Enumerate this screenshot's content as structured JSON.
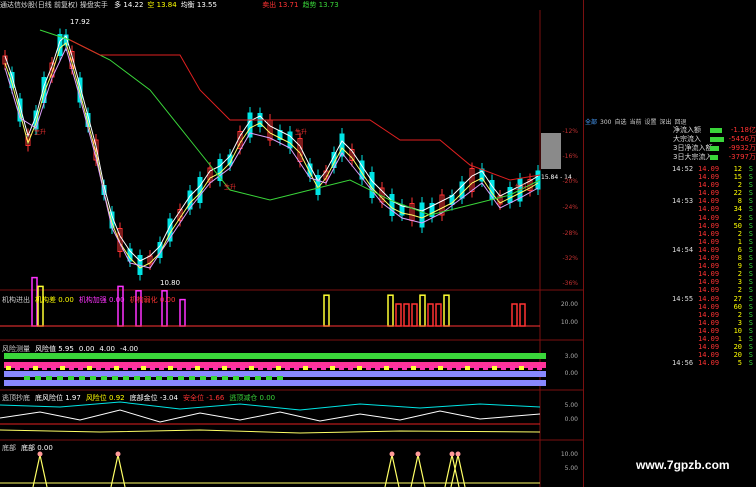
{
  "header": {
    "title": "通达信炒股(日线 前复权) 操盘实手",
    "items": [
      {
        "label": "多",
        "value": "14.22",
        "color": "#ffffff"
      },
      {
        "label": "空",
        "value": "13.84",
        "color": "#ffff00"
      },
      {
        "label": "均衡",
        "value": "13.55",
        "color": "#ffffff"
      }
    ],
    "right_items": [
      {
        "label": "卖出",
        "value": "13.71",
        "color": "#ff3333"
      },
      {
        "label": "趋势",
        "value": "13.73",
        "color": "#3ad63a"
      }
    ]
  },
  "main_chart": {
    "price_labels": {
      "high": "17.92",
      "low": "10.80",
      "last": "15.84 - 14"
    },
    "signal_labels": [
      "生升",
      "生升",
      "生升",
      "生升"
    ],
    "right_axis": [
      "-12%",
      "-16%",
      "-20%",
      "-24%",
      "-28%",
      "-32%",
      "-36%"
    ]
  },
  "panel1": {
    "labels": [
      {
        "text": "机构进出",
        "color": "#cccccc"
      },
      {
        "text": "机构差 0.00",
        "color": "#ffff00"
      },
      {
        "text": "机构加强 0.00",
        "color": "#ff33ff"
      },
      {
        "text": "机构弱化 0.00",
        "color": "#ff3333"
      }
    ],
    "axis": [
      "20.00",
      "10.00"
    ]
  },
  "panel2": {
    "labels": [
      {
        "text": "风险测量",
        "color": "#cccccc"
      },
      {
        "text": "风险值 5.95",
        "color": "#ffffff"
      },
      {
        "text": "0.00",
        "color": "#ffffff"
      },
      {
        "text": "4.00",
        "color": "#ffffff"
      },
      {
        "text": "-4.00",
        "color": "#ffffff"
      }
    ],
    "axis": [
      "3.00",
      "0.00"
    ]
  },
  "panel3": {
    "labels": [
      {
        "text": "逃顶抄底",
        "color": "#cccccc"
      },
      {
        "text": "底风险位 1.97",
        "color": "#ffffff"
      },
      {
        "text": "风险位 0.92",
        "color": "#ffff00"
      },
      {
        "text": "底部金位 -3.04",
        "color": "#ffffff"
      },
      {
        "text": "安全位 -1.66",
        "color": "#ff3333"
      },
      {
        "text": "逃顶减仓 0.00",
        "color": "#3ad63a"
      }
    ],
    "axis": [
      "5.00",
      "0.00"
    ]
  },
  "panel4": {
    "labels": [
      {
        "text": "底部",
        "color": "#cccccc"
      },
      {
        "text": "底部 0.00",
        "color": "#ffffff"
      }
    ],
    "axis": [
      "10.00",
      "5.00"
    ]
  },
  "right_panel": {
    "tabs": [
      "全部",
      "300",
      "自选",
      "当前",
      "设置",
      "深出",
      "回退"
    ],
    "tab_colors": {
      "active": "#4aa0ff"
    },
    "flow": [
      {
        "name": "净流入额",
        "value": "-1.18亿",
        "bar": 0.45
      },
      {
        "name": "大宗流入",
        "value": "-5456万",
        "bar": 0.55
      },
      {
        "name": "3日净流入额",
        "value": "-9932万",
        "bar": 0.35
      },
      {
        "name": "3日大宗流入",
        "value": "-3797万",
        "bar": 0.3
      }
    ],
    "ticks": [
      {
        "time": "14:52",
        "price": "14.09",
        "vol": "12",
        "dir": "S"
      },
      {
        "time": "",
        "price": "14.09",
        "vol": "15",
        "dir": "S"
      },
      {
        "time": "",
        "price": "14.09",
        "vol": "2",
        "dir": "S"
      },
      {
        "time": "",
        "price": "14.09",
        "vol": "22",
        "dir": "S"
      },
      {
        "time": "14:53",
        "price": "14.09",
        "vol": "8",
        "dir": "S"
      },
      {
        "time": "",
        "price": "14.09",
        "vol": "34",
        "dir": "S"
      },
      {
        "time": "",
        "price": "14.09",
        "vol": "2",
        "dir": "S"
      },
      {
        "time": "",
        "price": "14.09",
        "vol": "50",
        "dir": "S"
      },
      {
        "time": "",
        "price": "14.09",
        "vol": "2",
        "dir": "S"
      },
      {
        "time": "",
        "price": "14.09",
        "vol": "1",
        "dir": "S"
      },
      {
        "time": "14:54",
        "price": "14.09",
        "vol": "6",
        "dir": "S"
      },
      {
        "time": "",
        "price": "14.09",
        "vol": "8",
        "dir": "S"
      },
      {
        "time": "",
        "price": "14.09",
        "vol": "9",
        "dir": "S"
      },
      {
        "time": "",
        "price": "14.09",
        "vol": "2",
        "dir": "S"
      },
      {
        "time": "",
        "price": "14.09",
        "vol": "3",
        "dir": "S"
      },
      {
        "time": "",
        "price": "14.09",
        "vol": "2",
        "dir": "S"
      },
      {
        "time": "14:55",
        "price": "14.09",
        "vol": "27",
        "dir": "S"
      },
      {
        "time": "",
        "price": "14.09",
        "vol": "60",
        "dir": "S"
      },
      {
        "time": "",
        "price": "14.09",
        "vol": "2",
        "dir": "S"
      },
      {
        "time": "",
        "price": "14.09",
        "vol": "3",
        "dir": "S"
      },
      {
        "time": "",
        "price": "14.09",
        "vol": "10",
        "dir": "S"
      },
      {
        "time": "",
        "price": "14.09",
        "vol": "1",
        "dir": "S"
      },
      {
        "time": "",
        "price": "14.09",
        "vol": "20",
        "dir": "S"
      },
      {
        "time": "",
        "price": "14.09",
        "vol": "20",
        "dir": "S"
      },
      {
        "time": "14:56",
        "price": "14.09",
        "vol": "5",
        "dir": "S"
      }
    ]
  },
  "watermark": "www.7gpzb.com"
}
